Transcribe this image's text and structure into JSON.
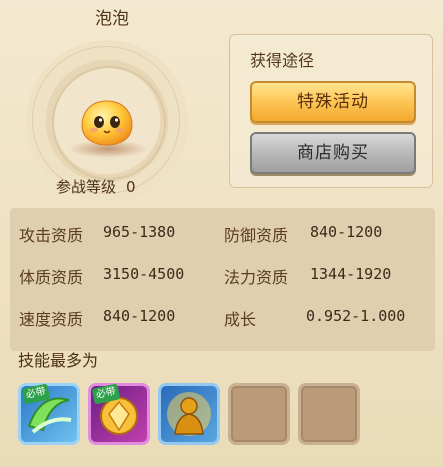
{
  "pet": {
    "name": "泡泡",
    "level_label": "参战等级",
    "level_value": "0"
  },
  "source": {
    "title": "获得途径",
    "buttons": [
      "特殊活动",
      "商店购买"
    ]
  },
  "stats": [
    {
      "label": "攻击资质",
      "value": "965-1380"
    },
    {
      "label": "防御资质",
      "value": "840-1200"
    },
    {
      "label": "体质资质",
      "value": "3150-4500"
    },
    {
      "label": "法力资质",
      "value": "1344-1920"
    },
    {
      "label": "速度资质",
      "value": "840-1200"
    },
    {
      "label": "成长",
      "value": "0.952-1.000"
    }
  ],
  "skills": {
    "title": "技能最多为",
    "slots": [
      {
        "icon": "green-wind-skill-icon",
        "badge": "必带"
      },
      {
        "icon": "golden-shield-skill-icon",
        "badge": "必带"
      },
      {
        "icon": "golden-buddha-skill-icon",
        "badge": ""
      },
      {
        "icon": "empty-slot",
        "badge": ""
      },
      {
        "icon": "empty-slot",
        "badge": ""
      }
    ]
  },
  "colors": {
    "accent": "#ffc85a",
    "shop_gray": "#b9b9b9",
    "badge_green": "#2da04a"
  }
}
